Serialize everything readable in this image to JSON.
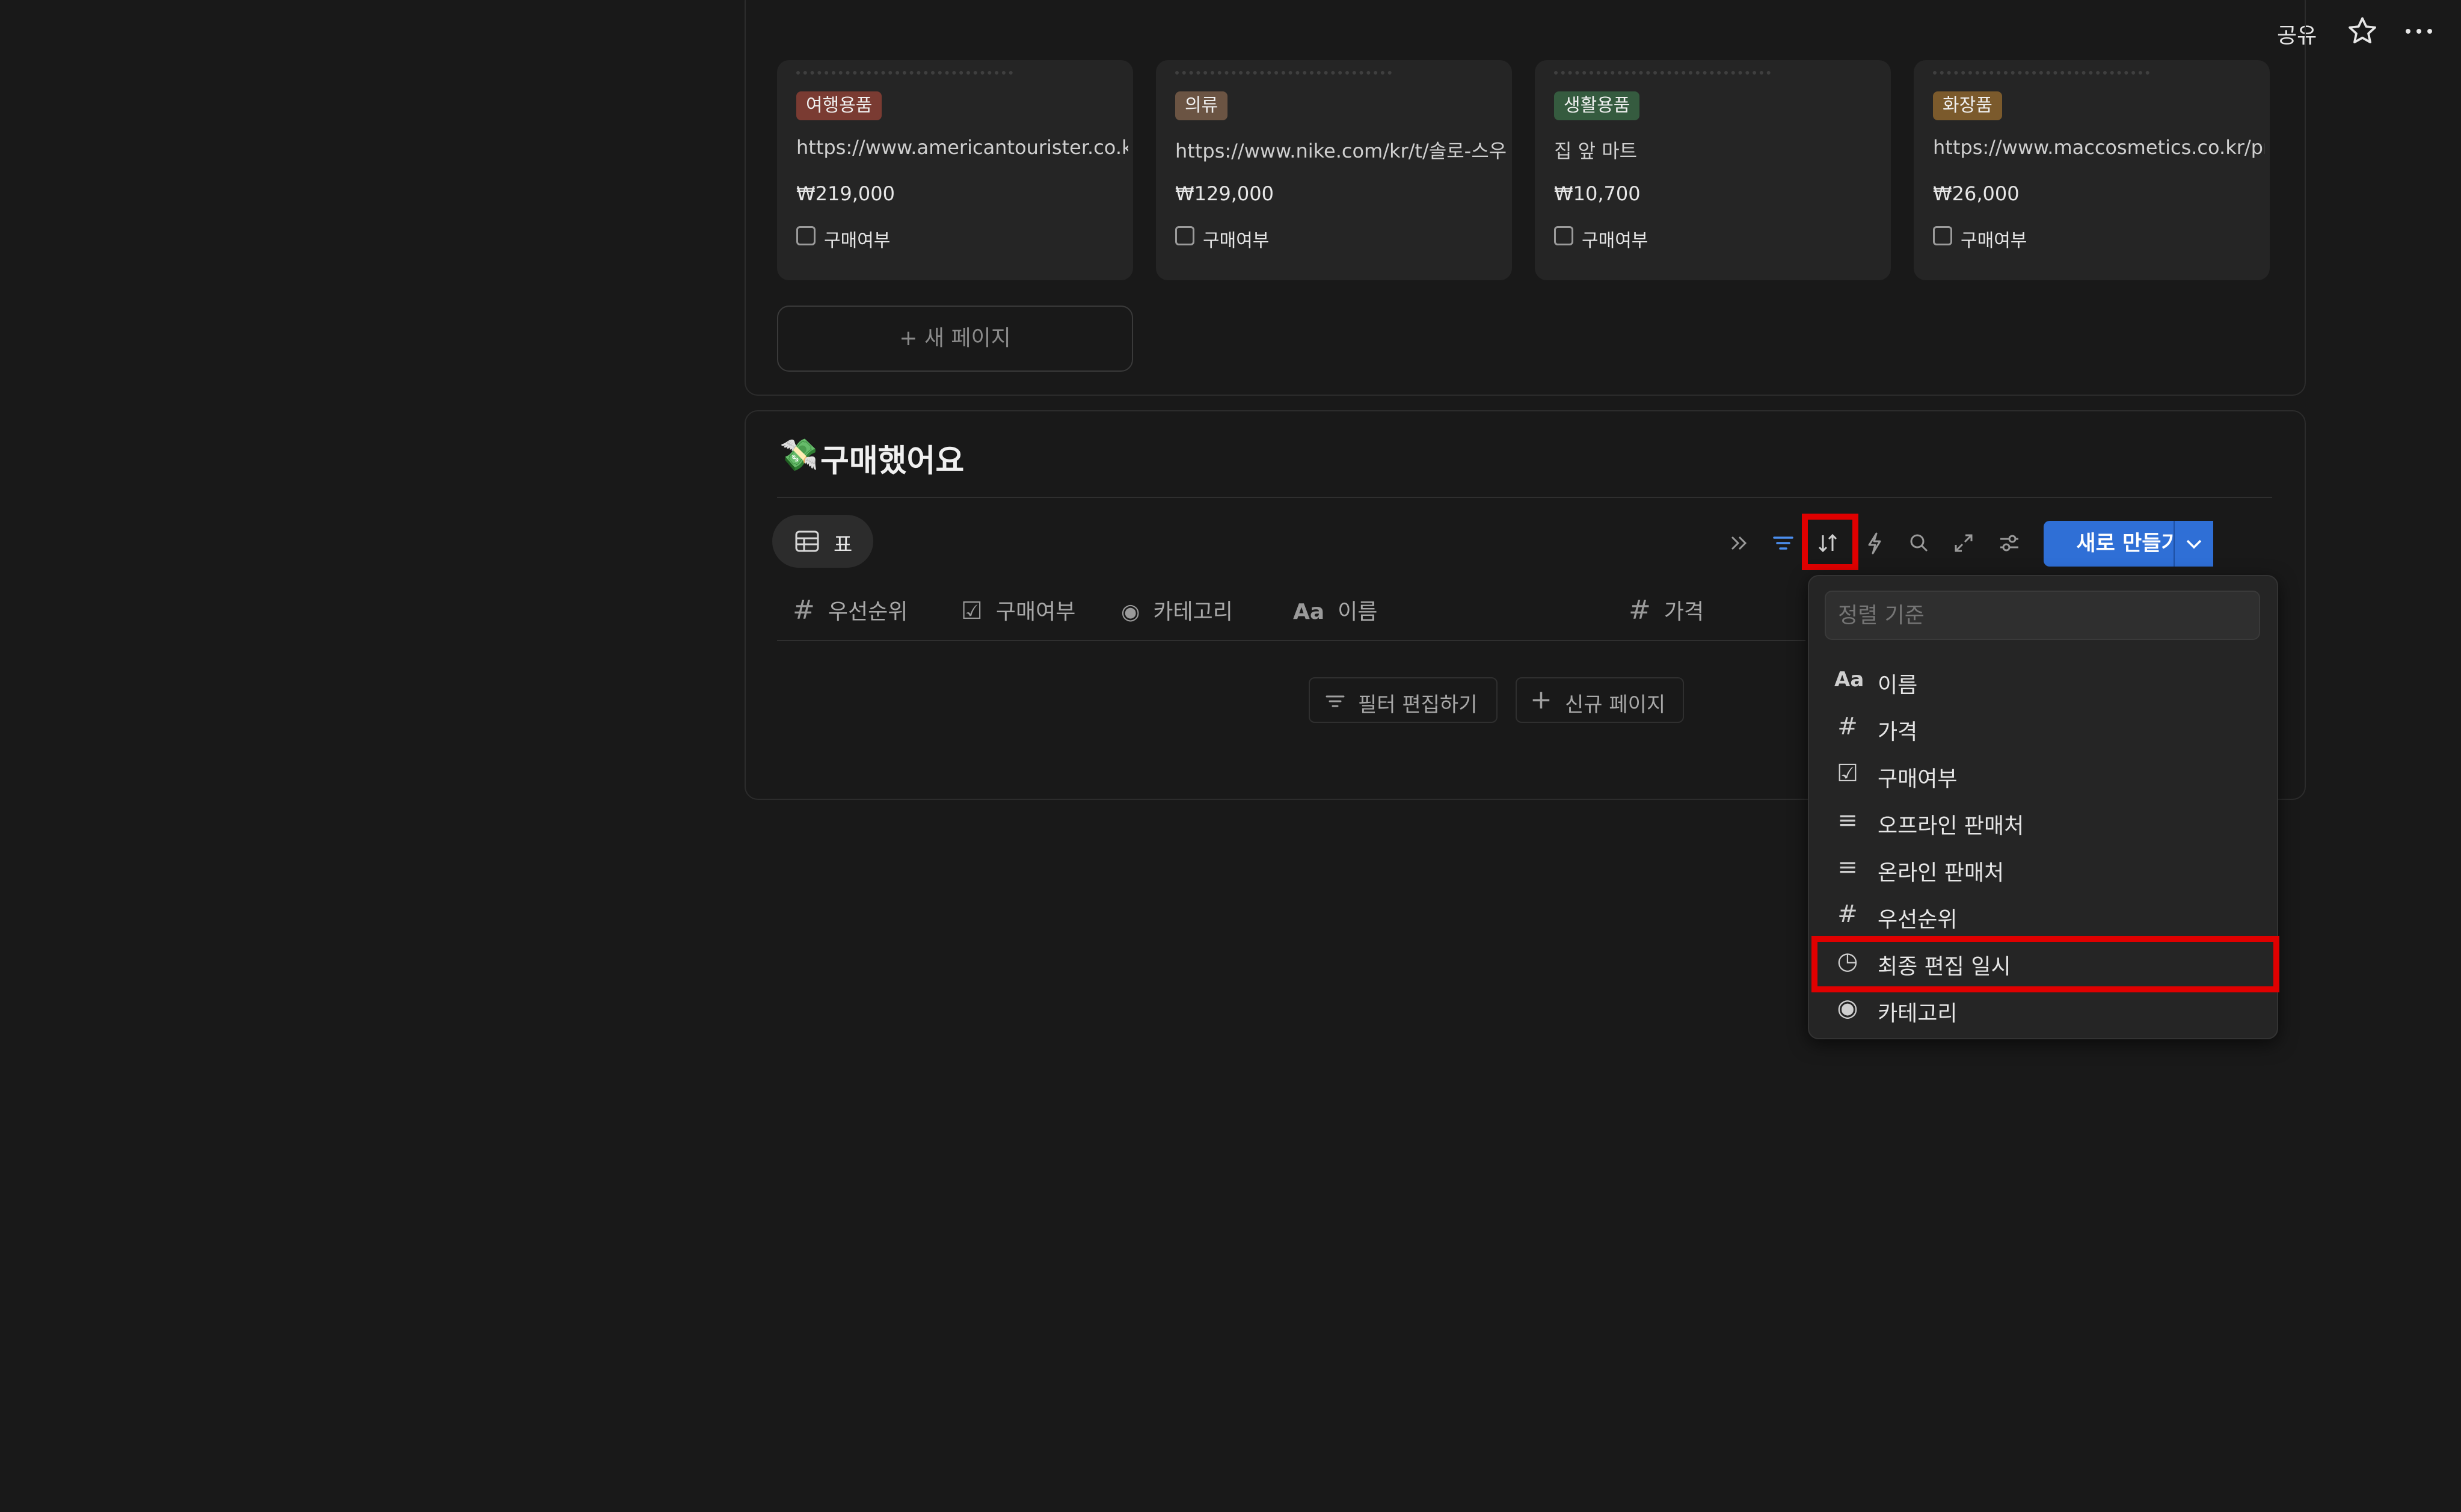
{
  "topbar": {
    "share_label": "공유",
    "star_icon": "star-icon",
    "more_icon": "more-icon"
  },
  "cards": [
    {
      "tag": "여행용품",
      "tag_color": "#7a3b32",
      "url": "https://www.americantourister.co.kr/s",
      "price": "₩219,000",
      "checkbox_label": "구매여부"
    },
    {
      "tag": "의류",
      "tag_color": "#6b5443",
      "url": "https://www.nike.com/kr/t/솔로-스우시-",
      "price": "₩129,000",
      "checkbox_label": "구매여부"
    },
    {
      "tag": "생활용품",
      "tag_color": "#355b3f",
      "url": "집 앞 마트",
      "price": "₩10,700",
      "checkbox_label": "구매여부"
    },
    {
      "tag": "화장품",
      "tag_color": "#7b5a2c",
      "url": "https://www.maccosmetics.co.kr/pro",
      "price": "₩26,000",
      "checkbox_label": "구매여부"
    }
  ],
  "new_page_label": "+ 새 페이지",
  "section": {
    "title": "구매했어요",
    "title_emoji": "💸",
    "view_tab_label": "표",
    "new_button_label": "새로 만들기"
  },
  "columns": [
    {
      "icon": "#",
      "label": "우선순위"
    },
    {
      "icon": "☑",
      "label": "구매여부"
    },
    {
      "icon": "◉",
      "label": "카테고리"
    },
    {
      "icon": "Aa",
      "label": "이름"
    },
    {
      "icon": "#",
      "label": "가격"
    }
  ],
  "empty_actions": {
    "filter_label": "필터 편집하기",
    "new_page_label": "신규 페이지"
  },
  "sort_menu": {
    "placeholder": "정렬 기준",
    "items": [
      {
        "icon": "Aa",
        "label": "이름"
      },
      {
        "icon": "#",
        "label": "가격"
      },
      {
        "icon": "☑",
        "label": "구매여부"
      },
      {
        "icon": "≡",
        "label": "오프라인 판매처"
      },
      {
        "icon": "≡",
        "label": "온라인 판매처"
      },
      {
        "icon": "#",
        "label": "우선순위"
      },
      {
        "icon": "◷",
        "label": "최종 편집 일시"
      },
      {
        "icon": "◉",
        "label": "카테고리"
      }
    ]
  },
  "colors": {
    "accent": "#2f6fd6",
    "highlight": "#e00000",
    "background": "#191919"
  }
}
